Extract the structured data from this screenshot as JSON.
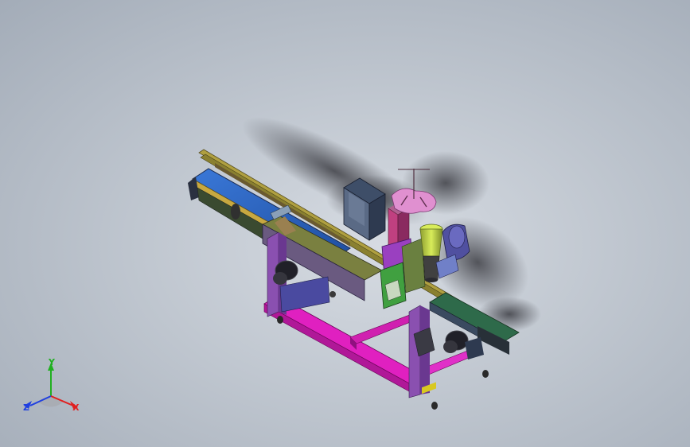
{
  "viewport": {
    "background": "#bfc6cf"
  },
  "triad": {
    "x_label": "X",
    "y_label": "Y",
    "z_label": "Z",
    "x_color": "#e02020",
    "y_color": "#20b020",
    "z_color": "#2040e0"
  },
  "model": {
    "frame_color": "#e020c0",
    "conveyor_belt_color": "#2a66c8",
    "rail_color": "#c8b43c",
    "upright_color": "#8a50b0",
    "control_box_color": "#4a5a70",
    "motor_color": "#202028",
    "lamp_color": "#c8e040",
    "label_disc_color": "#e090d0",
    "arm_color": "#5050a0"
  }
}
